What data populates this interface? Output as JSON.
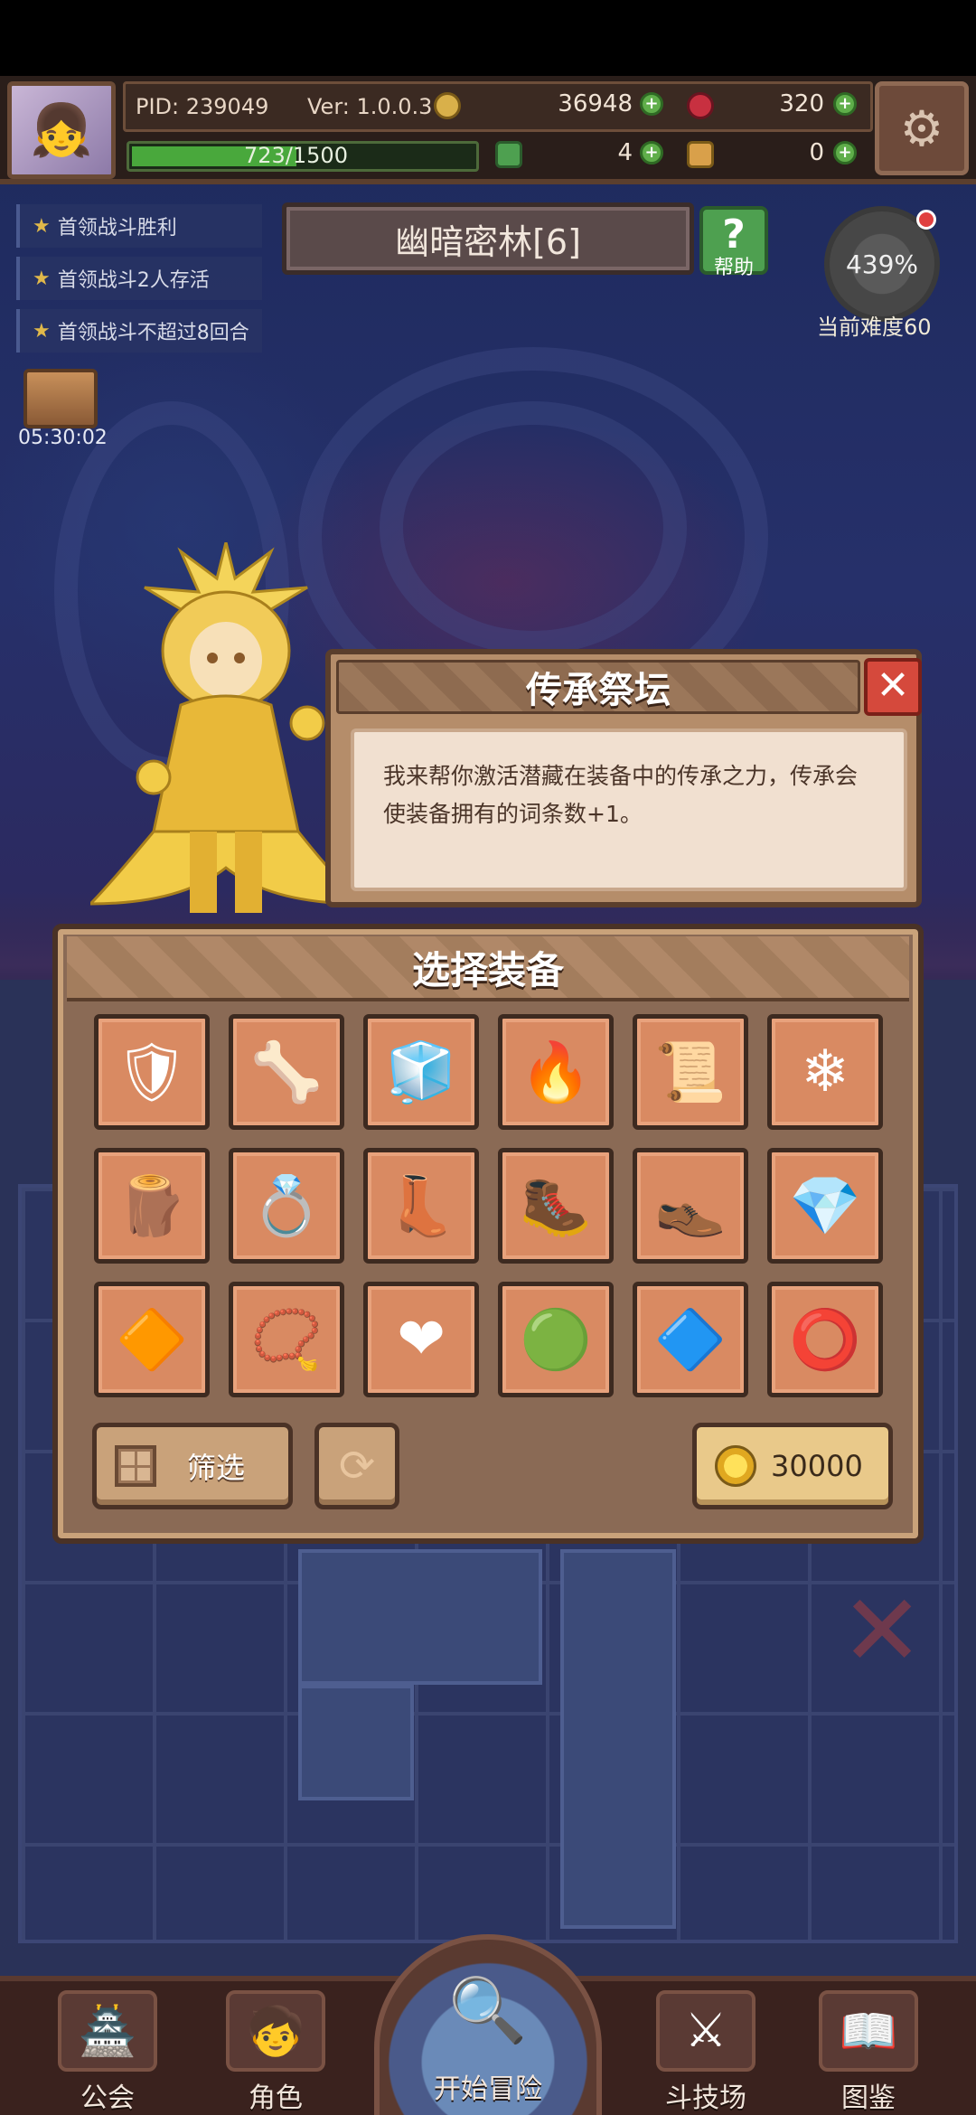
{
  "header": {
    "pid": "PID: 239049",
    "version": "Ver: 1.0.0.3",
    "gold": "36948",
    "gems": "320",
    "clover": "4",
    "tickets": "0",
    "xp": "723/1500",
    "xp_fraction": 0.482
  },
  "quests": [
    {
      "label": "首领战斗胜利"
    },
    {
      "label": "首领战斗2人存活"
    },
    {
      "label": "首领战斗不超过8回合"
    }
  ],
  "chest": {
    "timer": "05:30:02"
  },
  "level": {
    "title": "幽暗密林[6]",
    "help_label": "帮助",
    "difficulty_percent": "439%",
    "difficulty_label": "当前难度60"
  },
  "dialog": {
    "title": "传承祭坛",
    "close_glyph": "✕",
    "body": "我来帮你激活潜藏在装备中的传承之力，传承会使装备拥有的词条数+1。"
  },
  "equip_panel": {
    "title": "选择装备",
    "items": [
      {
        "icon": "ice-armor-icon",
        "glyph": "🛡"
      },
      {
        "icon": "bone-armor-icon",
        "glyph": "🦴"
      },
      {
        "icon": "crystal-armor-icon",
        "glyph": "🧊"
      },
      {
        "icon": "fire-armor-icon",
        "glyph": "🔥"
      },
      {
        "icon": "golden-scroll-icon",
        "glyph": "📜"
      },
      {
        "icon": "ice-helm-icon",
        "glyph": "❄"
      },
      {
        "icon": "leather-bracer-icon",
        "glyph": "🪵"
      },
      {
        "icon": "gold-ring-icon",
        "glyph": "💍"
      },
      {
        "icon": "gold-boots-icon",
        "glyph": "👢"
      },
      {
        "icon": "ice-boots-icon",
        "glyph": "🥾"
      },
      {
        "icon": "bone-boots-icon",
        "glyph": "👞"
      },
      {
        "icon": "ice-crystal-icon",
        "glyph": "💎"
      },
      {
        "icon": "ruby-gem-icon",
        "glyph": "🔶"
      },
      {
        "icon": "gold-necklace-icon",
        "glyph": "📿"
      },
      {
        "icon": "ruby-necklace-icon",
        "glyph": "❤"
      },
      {
        "icon": "emerald-necklace-icon",
        "glyph": "🟢"
      },
      {
        "icon": "diamond-necklace-icon",
        "glyph": "🔷"
      },
      {
        "icon": "fire-ring-icon",
        "glyph": "⭕"
      }
    ],
    "filter_label": "筛选",
    "refresh_glyph": "⟳",
    "cost": "30000"
  },
  "bottom_nav": [
    {
      "label": "公会",
      "glyph": "🏯"
    },
    {
      "label": "角色",
      "glyph": "🧒"
    },
    {
      "label": "开始冒险",
      "glyph": "🔍"
    },
    {
      "label": "斗技场",
      "glyph": "⚔"
    },
    {
      "label": "图鉴",
      "glyph": "📖"
    }
  ],
  "colors": {
    "accent_red": "#d5493c",
    "panel_brown": "#8a6a55",
    "slot_orange": "#d98a62",
    "xp_green": "#49a83c"
  }
}
